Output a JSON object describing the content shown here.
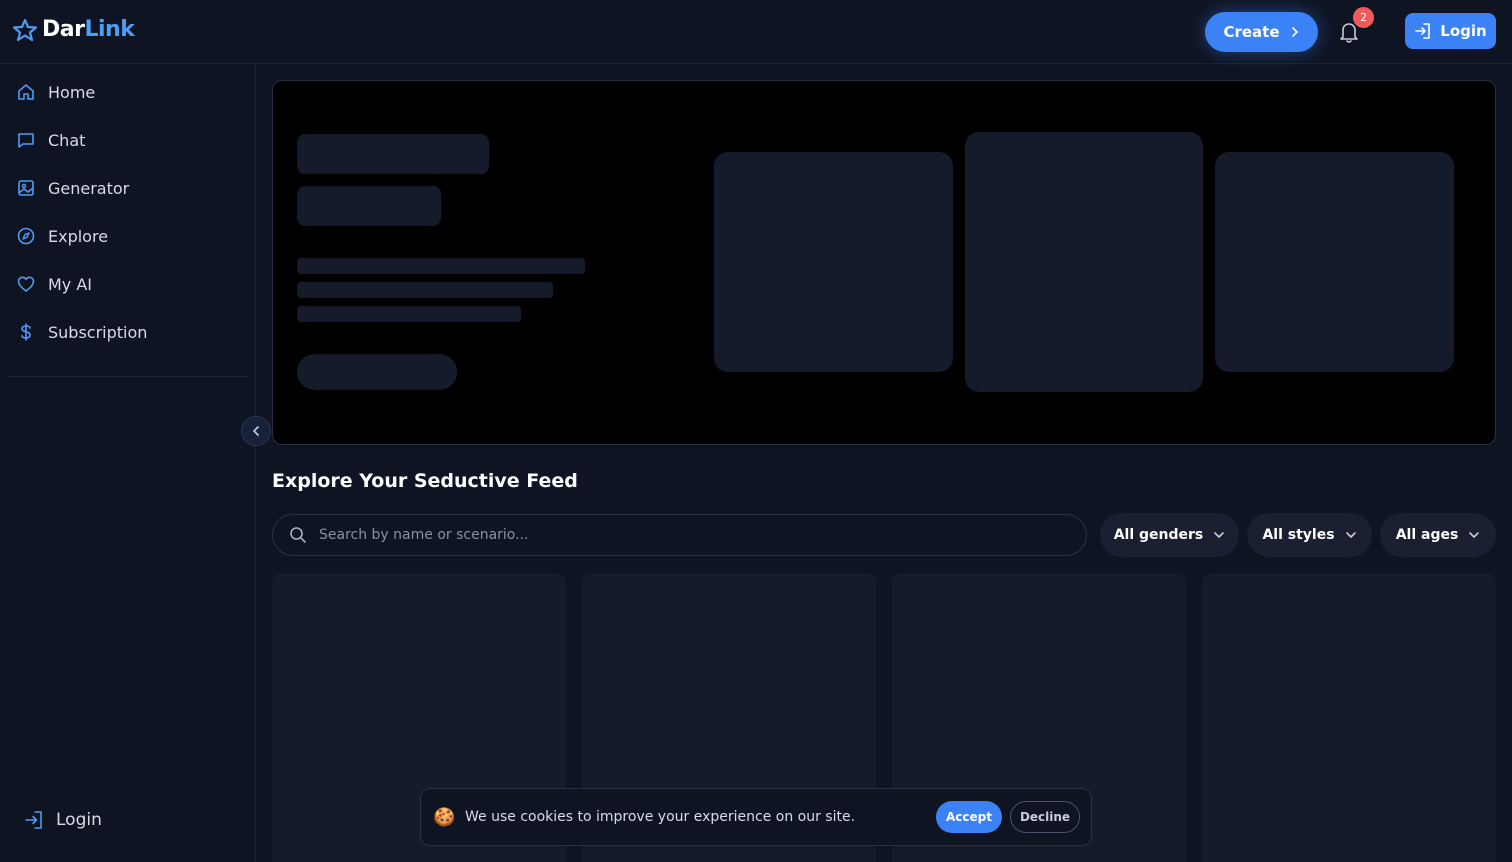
{
  "header": {
    "logo_part1": "Dar",
    "logo_part2": "Link",
    "create_label": "Create",
    "notification_count": "2",
    "login_label": "Login"
  },
  "sidebar": {
    "items": [
      {
        "label": "Home",
        "icon": "home-icon"
      },
      {
        "label": "Chat",
        "icon": "chat-icon"
      },
      {
        "label": "Generator",
        "icon": "image-icon"
      },
      {
        "label": "Explore",
        "icon": "compass-icon"
      },
      {
        "label": "My AI",
        "icon": "heart-icon"
      },
      {
        "label": "Subscription",
        "icon": "dollar-icon"
      }
    ],
    "login_label": "Login"
  },
  "main": {
    "section_title": "Explore Your Seductive Feed",
    "search_placeholder": "Search by name or scenario...",
    "filters": [
      {
        "label": "All genders"
      },
      {
        "label": "All styles"
      },
      {
        "label": "All ages"
      }
    ]
  },
  "cookie_banner": {
    "icon": "cookie-icon",
    "text": "We use cookies to improve your experience on our site.",
    "accept_label": "Accept",
    "decline_label": "Decline"
  },
  "colors": {
    "accent": "#3b82f6",
    "badge": "#f05a5a",
    "background": "#0f1423"
  }
}
